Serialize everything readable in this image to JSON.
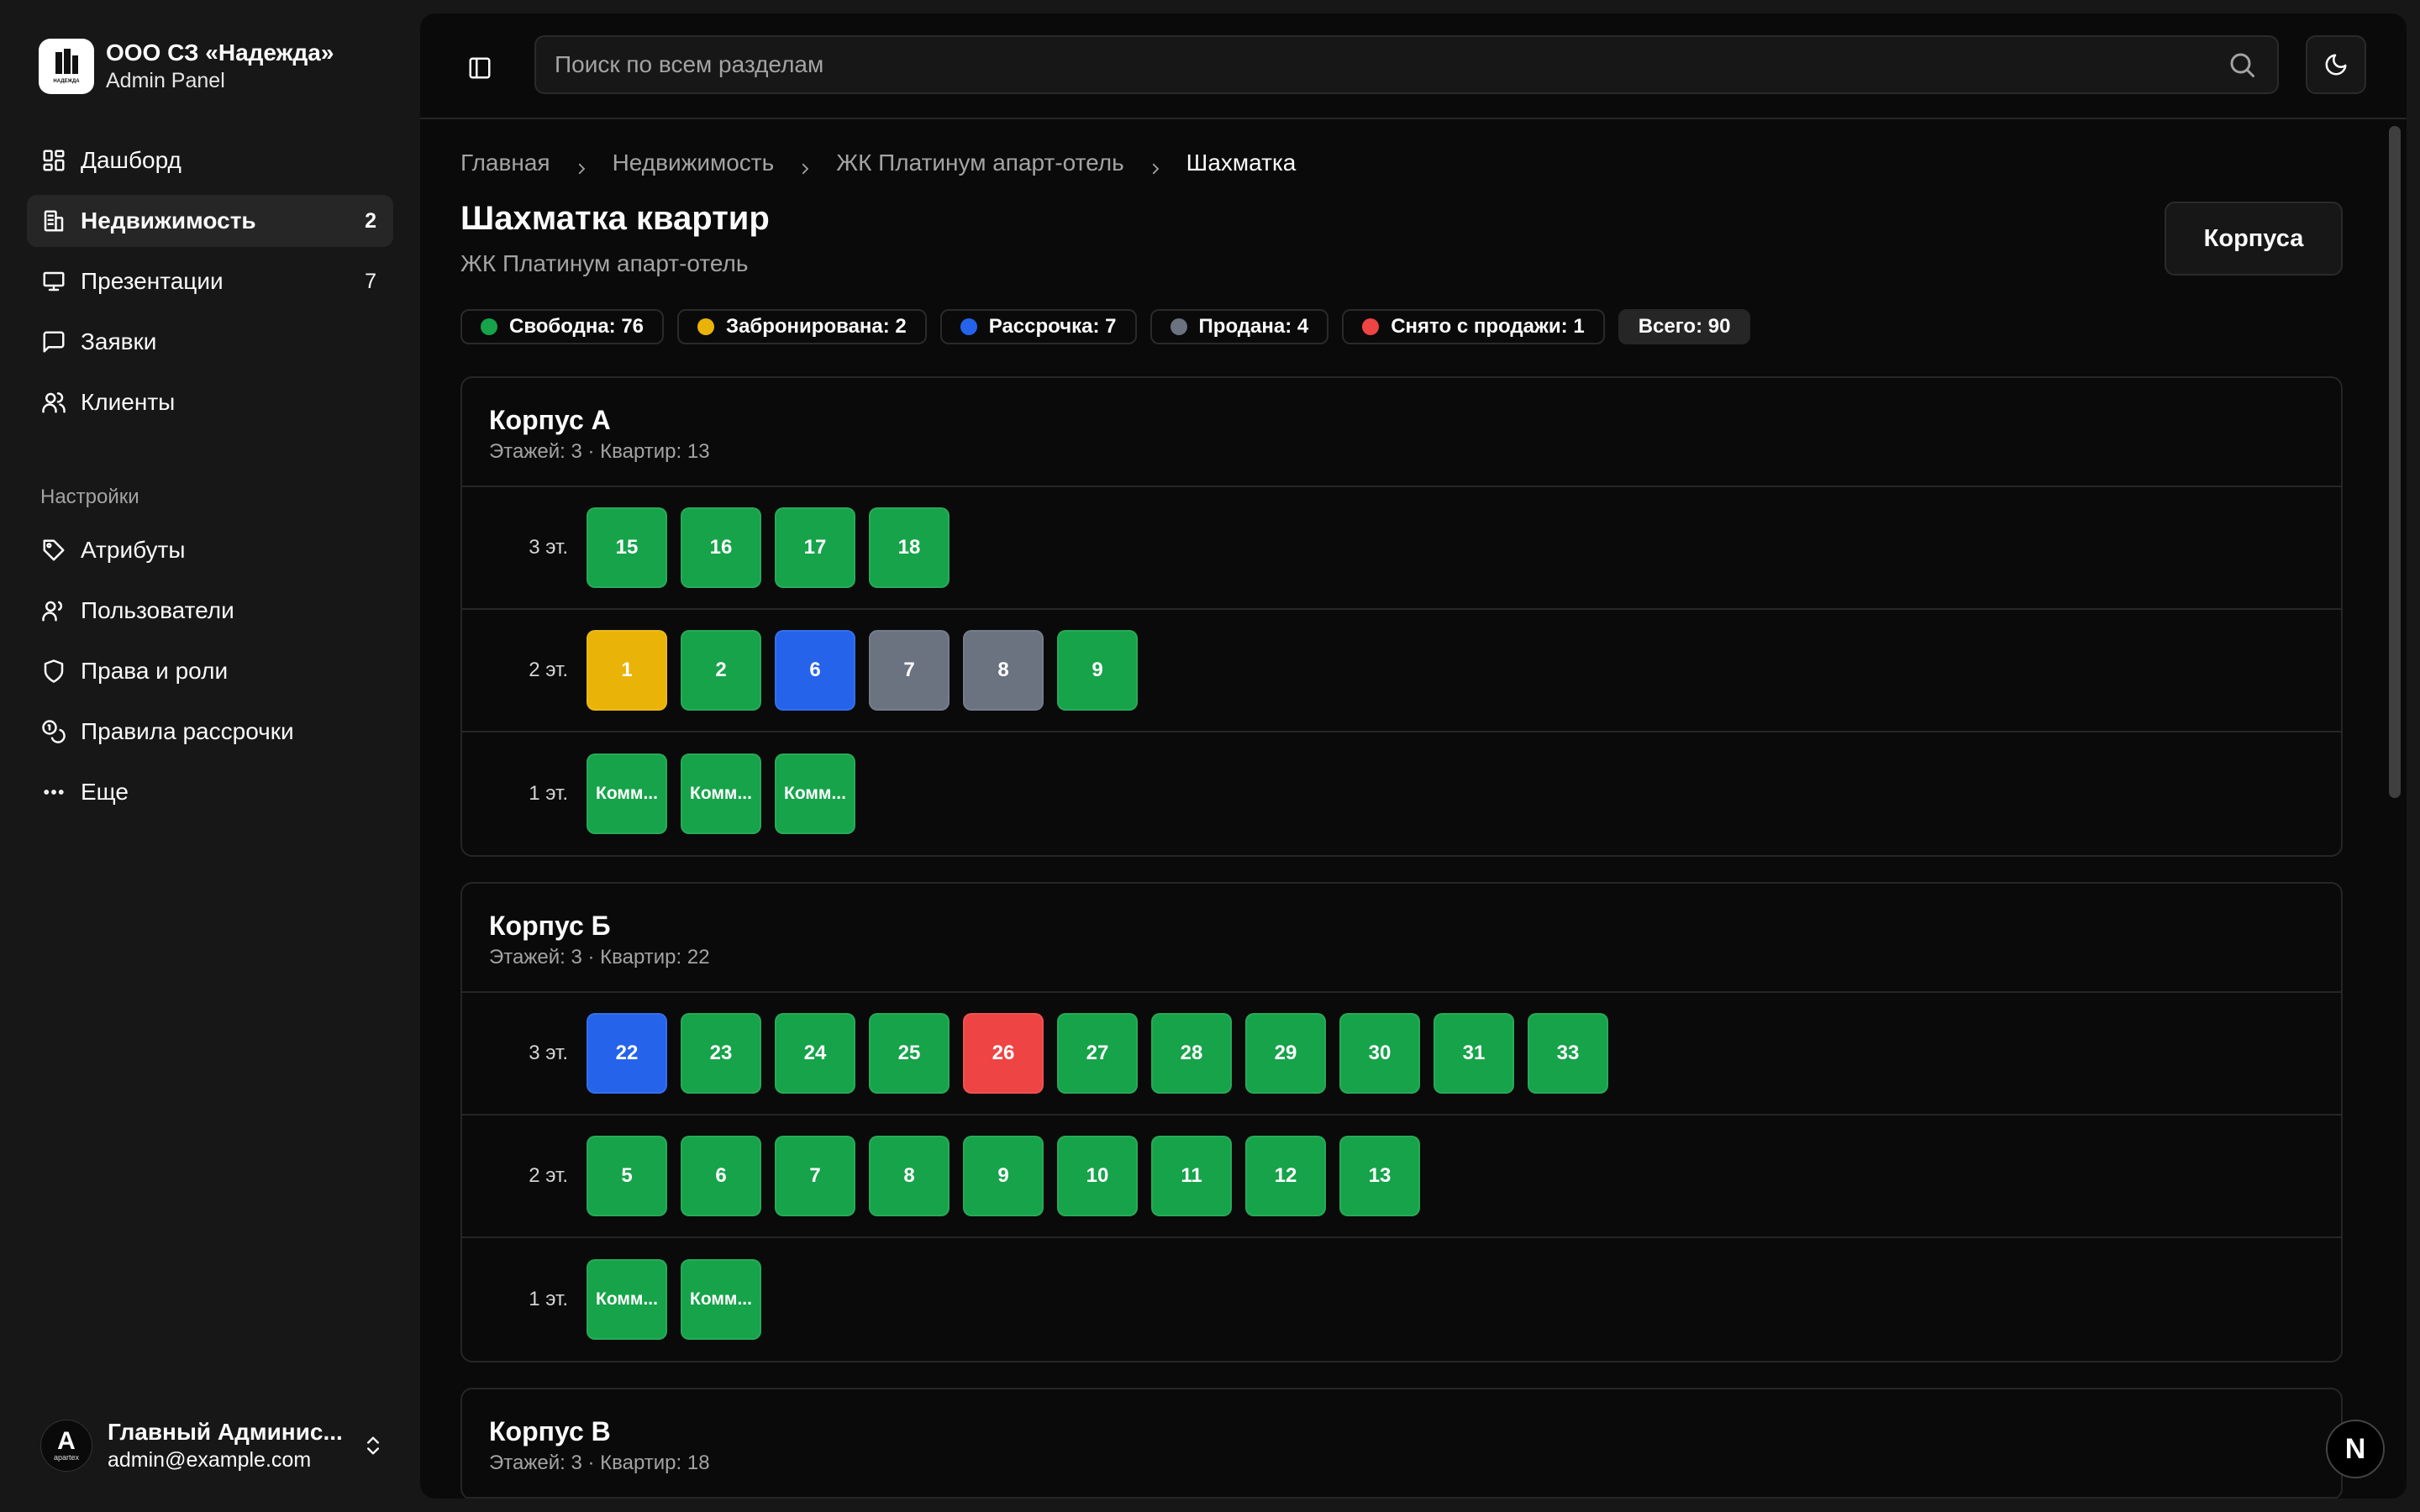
{
  "brand": {
    "title": "ООО СЗ «Надежда»",
    "subtitle": "Admin Panel",
    "logo_text": "НАДЕЖДА"
  },
  "nav": [
    {
      "label": "Дашборд",
      "icon": "dashboard-icon",
      "count": ""
    },
    {
      "label": "Недвижимость",
      "icon": "building-icon",
      "count": "2",
      "active": true
    },
    {
      "label": "Презентации",
      "icon": "presentation-icon",
      "count": "7"
    },
    {
      "label": "Заявки",
      "icon": "message-icon",
      "count": ""
    },
    {
      "label": "Клиенты",
      "icon": "users-icon",
      "count": ""
    }
  ],
  "settings_label": "Настройки",
  "settings_nav": [
    {
      "label": "Атрибуты",
      "icon": "tag-icon"
    },
    {
      "label": "Пользователи",
      "icon": "user-icon"
    },
    {
      "label": "Права и роли",
      "icon": "shield-icon"
    },
    {
      "label": "Правила рассрочки",
      "icon": "coins-icon"
    },
    {
      "label": "Еще",
      "icon": "more-icon"
    }
  ],
  "user": {
    "name": "Главный Админис...",
    "email": "admin@example.com",
    "avatar_letter": "A",
    "avatar_sub": "apartex"
  },
  "search": {
    "placeholder": "Поиск по всем разделам"
  },
  "breadcrumb": [
    "Главная",
    "Недвижимость",
    "ЖК Платинум апарт-отель",
    "Шахматка"
  ],
  "page": {
    "title": "Шахматка квартир",
    "subtitle": "ЖК Платинум апарт-отель",
    "korpusa_button": "Корпуса"
  },
  "colors": {
    "free": "#16a34a",
    "booked": "#eab308",
    "installment": "#2563eb",
    "sold": "#6b7280",
    "withdrawn": "#ef4444"
  },
  "legend": [
    {
      "label": "Свободна: 76",
      "status": "free"
    },
    {
      "label": "Забронирована: 2",
      "status": "booked"
    },
    {
      "label": "Рассрочка: 7",
      "status": "installment"
    },
    {
      "label": "Продана: 4",
      "status": "sold"
    },
    {
      "label": "Снято с продажи: 1",
      "status": "withdrawn"
    }
  ],
  "total": "Всего: 90",
  "buildings": [
    {
      "title": "Корпус А",
      "subtitle": "Этажей: 3 · Квартир: 13",
      "floors": [
        {
          "label": "3 эт.",
          "units": [
            {
              "n": "15",
              "s": "free"
            },
            {
              "n": "16",
              "s": "free"
            },
            {
              "n": "17",
              "s": "free"
            },
            {
              "n": "18",
              "s": "free"
            }
          ]
        },
        {
          "label": "2 эт.",
          "units": [
            {
              "n": "1",
              "s": "booked"
            },
            {
              "n": "2",
              "s": "free"
            },
            {
              "n": "6",
              "s": "installment"
            },
            {
              "n": "7",
              "s": "sold"
            },
            {
              "n": "8",
              "s": "sold"
            },
            {
              "n": "9",
              "s": "free"
            }
          ]
        },
        {
          "label": "1 эт.",
          "units": [
            {
              "n": "Комм...",
              "s": "free"
            },
            {
              "n": "Комм...",
              "s": "free"
            },
            {
              "n": "Комм...",
              "s": "free"
            }
          ]
        }
      ]
    },
    {
      "title": "Корпус Б",
      "subtitle": "Этажей: 3 · Квартир: 22",
      "floors": [
        {
          "label": "3 эт.",
          "units": [
            {
              "n": "22",
              "s": "installment"
            },
            {
              "n": "23",
              "s": "free"
            },
            {
              "n": "24",
              "s": "free"
            },
            {
              "n": "25",
              "s": "free"
            },
            {
              "n": "26",
              "s": "withdrawn"
            },
            {
              "n": "27",
              "s": "free"
            },
            {
              "n": "28",
              "s": "free"
            },
            {
              "n": "29",
              "s": "free"
            },
            {
              "n": "30",
              "s": "free"
            },
            {
              "n": "31",
              "s": "free"
            },
            {
              "n": "33",
              "s": "free"
            }
          ]
        },
        {
          "label": "2 эт.",
          "units": [
            {
              "n": "5",
              "s": "free"
            },
            {
              "n": "6",
              "s": "free"
            },
            {
              "n": "7",
              "s": "free"
            },
            {
              "n": "8",
              "s": "free"
            },
            {
              "n": "9",
              "s": "free"
            },
            {
              "n": "10",
              "s": "free"
            },
            {
              "n": "11",
              "s": "free"
            },
            {
              "n": "12",
              "s": "free"
            },
            {
              "n": "13",
              "s": "free"
            }
          ]
        },
        {
          "label": "1 эт.",
          "units": [
            {
              "n": "Комм...",
              "s": "free"
            },
            {
              "n": "Комм...",
              "s": "free"
            }
          ]
        }
      ]
    },
    {
      "title": "Корпус В",
      "subtitle": "Этажей: 3 · Квартир: 18",
      "floors": []
    }
  ],
  "badge": "N"
}
